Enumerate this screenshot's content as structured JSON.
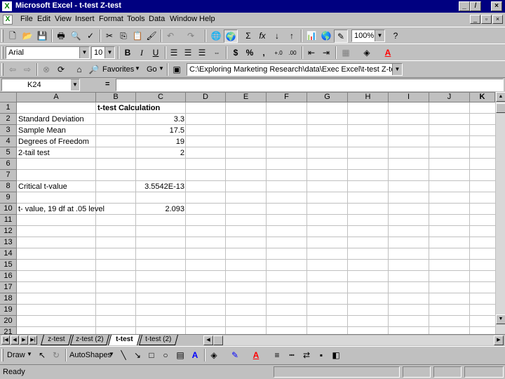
{
  "window": {
    "title": "Microsoft Excel - t-test Z-test",
    "app_icon": "excel-icon",
    "controls": [
      "_",
      "̸",
      "×"
    ]
  },
  "menubar": {
    "items": [
      "File",
      "Edit",
      "View",
      "Insert",
      "Format",
      "Tools",
      "Data",
      "Window",
      "Help"
    ]
  },
  "standard_toolbar": {
    "zoom": "100%"
  },
  "formatting_toolbar": {
    "font": "Arial",
    "font_size": "10",
    "bold": "B",
    "italic": "I",
    "underline": "U",
    "currency": "$",
    "percent": "%",
    "comma": ",",
    "inc_decimal": "+.0",
    "dec_decimal": ".00"
  },
  "web_toolbar": {
    "favorites": "Favorites",
    "go": "Go",
    "address": "C:\\Exploring Marketing Research\\data\\Exec Excel\\t-test Z-test.xls"
  },
  "formula_bar": {
    "name_box": "K24",
    "equals": "=",
    "formula": ""
  },
  "sheet": {
    "columns": [
      "A",
      "B",
      "C",
      "D",
      "E",
      "F",
      "G",
      "H",
      "I",
      "J",
      "K"
    ],
    "rows": [
      "1",
      "2",
      "3",
      "4",
      "5",
      "6",
      "7",
      "8",
      "9",
      "10",
      "11",
      "12",
      "13",
      "14",
      "15",
      "16",
      "17",
      "18",
      "19",
      "20",
      "21"
    ],
    "cells": {
      "B1": "t-test Calculation",
      "A2": "Standard Deviation",
      "C2": "3.3",
      "A3": "Sample Mean",
      "C3": "17.5",
      "A4": "Degrees of Freedom",
      "C4": "19",
      "A5": "2-tail test",
      "C5": "2",
      "A8": "Critical t-value",
      "C8": "3.5542E-13",
      "A10": "t- value, 19 df at .05 level",
      "C10": "2.093"
    }
  },
  "sheet_tabs": [
    "z-test",
    "z-test (2)",
    "t-test",
    "t-test (2)"
  ],
  "active_tab": "t-test",
  "drawing_toolbar": {
    "draw": "Draw",
    "autoshapes": "AutoShapes"
  },
  "status": {
    "text": "Ready"
  }
}
